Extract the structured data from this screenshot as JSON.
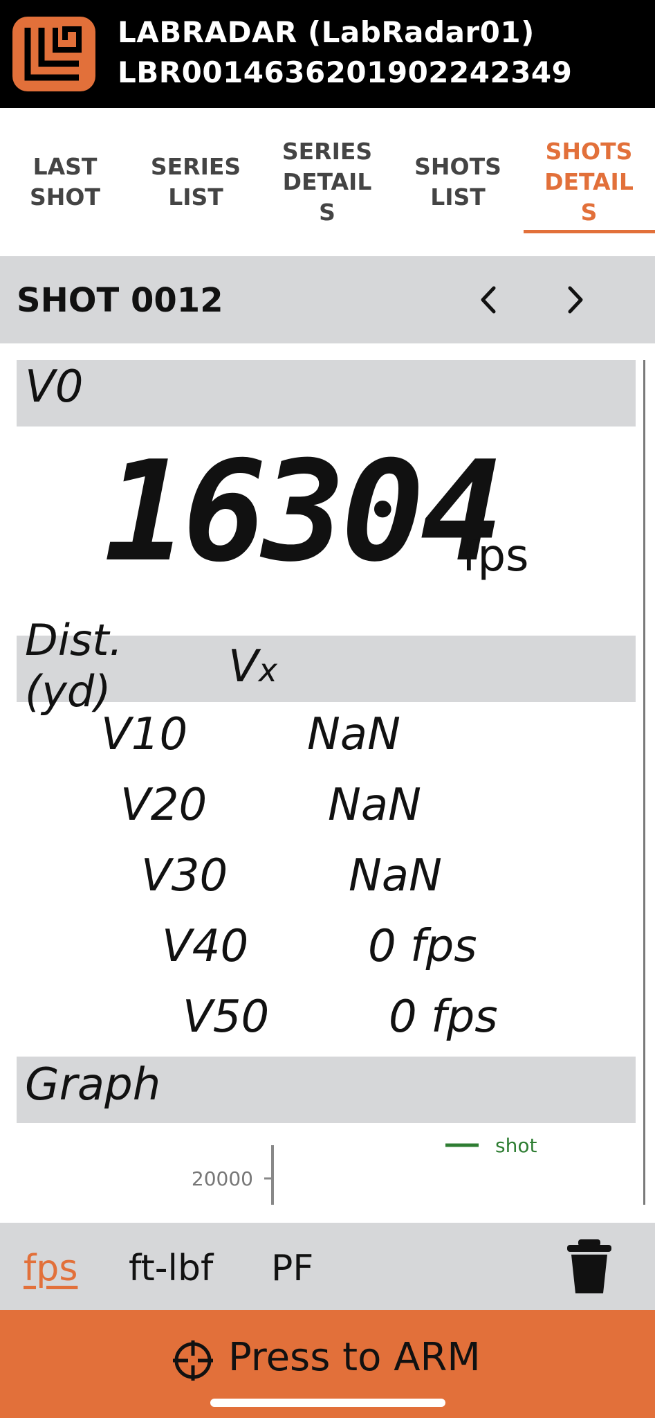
{
  "header": {
    "device_name": "LABRADAR (LabRadar01)",
    "serial": "LBR0014636201902242349",
    "logo_icon": "labradar-logo-icon",
    "colors": {
      "accent": "#e2703a",
      "header_bg": "#000000"
    }
  },
  "tabs": [
    {
      "label": "LAST\nSHOT",
      "active": false
    },
    {
      "label": "SERIES\nLIST",
      "active": false
    },
    {
      "label": "SERIES\nDETAIL\nS",
      "active": false
    },
    {
      "label": "SHOTS\nLIST",
      "active": false
    },
    {
      "label": "SHOTS\nDETAIL\nS",
      "active": true
    }
  ],
  "shot": {
    "title": "SHOT 0012",
    "prev_icon": "chevron-left-icon",
    "next_icon": "chevron-right-icon"
  },
  "v0": {
    "label": "V0",
    "value": "16304",
    "unit": "fps"
  },
  "velocities": {
    "dist_label": "Dist.\n(yd)",
    "vx_label_main": "V",
    "vx_label_sub": "x",
    "rows": [
      {
        "name": "V10",
        "value": "NaN"
      },
      {
        "name": "V20",
        "value": "NaN"
      },
      {
        "name": "V30",
        "value": "NaN"
      },
      {
        "name": "V40",
        "value": "0 fps"
      },
      {
        "name": "V50",
        "value": "0 fps"
      }
    ]
  },
  "graph": {
    "label": "Graph",
    "y_tick": "20000",
    "legend": "shot",
    "series_color": "#2e7d32"
  },
  "units": {
    "options": [
      "fps",
      "ft-lbf",
      "PF"
    ],
    "selected": "fps",
    "delete_icon": "trash-icon"
  },
  "arm": {
    "label": "Press to ARM",
    "icon": "crosshair-icon"
  }
}
